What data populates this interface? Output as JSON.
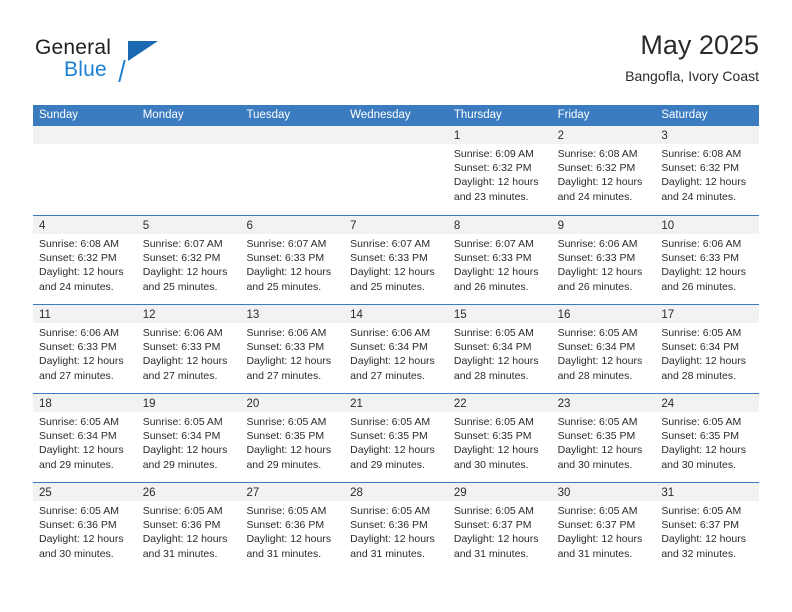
{
  "brand": {
    "name_top": "General",
    "name_bottom": "Blue",
    "triangle_color": "#1b68b3",
    "blue_text_color": "#1b7fd4"
  },
  "header": {
    "title": "May 2025",
    "subtitle": "Bangofla, Ivory Coast"
  },
  "theme": {
    "header_band": "#3b7cc0",
    "day_number_band": "#f2f2f2",
    "text": "#2b2b2b"
  },
  "weekdays": [
    "Sunday",
    "Monday",
    "Tuesday",
    "Wednesday",
    "Thursday",
    "Friday",
    "Saturday"
  ],
  "weeks": [
    [
      {
        "day": "",
        "lines": []
      },
      {
        "day": "",
        "lines": []
      },
      {
        "day": "",
        "lines": []
      },
      {
        "day": "",
        "lines": []
      },
      {
        "day": "1",
        "lines": [
          "Sunrise: 6:09 AM",
          "Sunset: 6:32 PM",
          "Daylight: 12 hours",
          "and 23 minutes."
        ]
      },
      {
        "day": "2",
        "lines": [
          "Sunrise: 6:08 AM",
          "Sunset: 6:32 PM",
          "Daylight: 12 hours",
          "and 24 minutes."
        ]
      },
      {
        "day": "3",
        "lines": [
          "Sunrise: 6:08 AM",
          "Sunset: 6:32 PM",
          "Daylight: 12 hours",
          "and 24 minutes."
        ]
      }
    ],
    [
      {
        "day": "4",
        "lines": [
          "Sunrise: 6:08 AM",
          "Sunset: 6:32 PM",
          "Daylight: 12 hours",
          "and 24 minutes."
        ]
      },
      {
        "day": "5",
        "lines": [
          "Sunrise: 6:07 AM",
          "Sunset: 6:32 PM",
          "Daylight: 12 hours",
          "and 25 minutes."
        ]
      },
      {
        "day": "6",
        "lines": [
          "Sunrise: 6:07 AM",
          "Sunset: 6:33 PM",
          "Daylight: 12 hours",
          "and 25 minutes."
        ]
      },
      {
        "day": "7",
        "lines": [
          "Sunrise: 6:07 AM",
          "Sunset: 6:33 PM",
          "Daylight: 12 hours",
          "and 25 minutes."
        ]
      },
      {
        "day": "8",
        "lines": [
          "Sunrise: 6:07 AM",
          "Sunset: 6:33 PM",
          "Daylight: 12 hours",
          "and 26 minutes."
        ]
      },
      {
        "day": "9",
        "lines": [
          "Sunrise: 6:06 AM",
          "Sunset: 6:33 PM",
          "Daylight: 12 hours",
          "and 26 minutes."
        ]
      },
      {
        "day": "10",
        "lines": [
          "Sunrise: 6:06 AM",
          "Sunset: 6:33 PM",
          "Daylight: 12 hours",
          "and 26 minutes."
        ]
      }
    ],
    [
      {
        "day": "11",
        "lines": [
          "Sunrise: 6:06 AM",
          "Sunset: 6:33 PM",
          "Daylight: 12 hours",
          "and 27 minutes."
        ]
      },
      {
        "day": "12",
        "lines": [
          "Sunrise: 6:06 AM",
          "Sunset: 6:33 PM",
          "Daylight: 12 hours",
          "and 27 minutes."
        ]
      },
      {
        "day": "13",
        "lines": [
          "Sunrise: 6:06 AM",
          "Sunset: 6:33 PM",
          "Daylight: 12 hours",
          "and 27 minutes."
        ]
      },
      {
        "day": "14",
        "lines": [
          "Sunrise: 6:06 AM",
          "Sunset: 6:34 PM",
          "Daylight: 12 hours",
          "and 27 minutes."
        ]
      },
      {
        "day": "15",
        "lines": [
          "Sunrise: 6:05 AM",
          "Sunset: 6:34 PM",
          "Daylight: 12 hours",
          "and 28 minutes."
        ]
      },
      {
        "day": "16",
        "lines": [
          "Sunrise: 6:05 AM",
          "Sunset: 6:34 PM",
          "Daylight: 12 hours",
          "and 28 minutes."
        ]
      },
      {
        "day": "17",
        "lines": [
          "Sunrise: 6:05 AM",
          "Sunset: 6:34 PM",
          "Daylight: 12 hours",
          "and 28 minutes."
        ]
      }
    ],
    [
      {
        "day": "18",
        "lines": [
          "Sunrise: 6:05 AM",
          "Sunset: 6:34 PM",
          "Daylight: 12 hours",
          "and 29 minutes."
        ]
      },
      {
        "day": "19",
        "lines": [
          "Sunrise: 6:05 AM",
          "Sunset: 6:34 PM",
          "Daylight: 12 hours",
          "and 29 minutes."
        ]
      },
      {
        "day": "20",
        "lines": [
          "Sunrise: 6:05 AM",
          "Sunset: 6:35 PM",
          "Daylight: 12 hours",
          "and 29 minutes."
        ]
      },
      {
        "day": "21",
        "lines": [
          "Sunrise: 6:05 AM",
          "Sunset: 6:35 PM",
          "Daylight: 12 hours",
          "and 29 minutes."
        ]
      },
      {
        "day": "22",
        "lines": [
          "Sunrise: 6:05 AM",
          "Sunset: 6:35 PM",
          "Daylight: 12 hours",
          "and 30 minutes."
        ]
      },
      {
        "day": "23",
        "lines": [
          "Sunrise: 6:05 AM",
          "Sunset: 6:35 PM",
          "Daylight: 12 hours",
          "and 30 minutes."
        ]
      },
      {
        "day": "24",
        "lines": [
          "Sunrise: 6:05 AM",
          "Sunset: 6:35 PM",
          "Daylight: 12 hours",
          "and 30 minutes."
        ]
      }
    ],
    [
      {
        "day": "25",
        "lines": [
          "Sunrise: 6:05 AM",
          "Sunset: 6:36 PM",
          "Daylight: 12 hours",
          "and 30 minutes."
        ]
      },
      {
        "day": "26",
        "lines": [
          "Sunrise: 6:05 AM",
          "Sunset: 6:36 PM",
          "Daylight: 12 hours",
          "and 31 minutes."
        ]
      },
      {
        "day": "27",
        "lines": [
          "Sunrise: 6:05 AM",
          "Sunset: 6:36 PM",
          "Daylight: 12 hours",
          "and 31 minutes."
        ]
      },
      {
        "day": "28",
        "lines": [
          "Sunrise: 6:05 AM",
          "Sunset: 6:36 PM",
          "Daylight: 12 hours",
          "and 31 minutes."
        ]
      },
      {
        "day": "29",
        "lines": [
          "Sunrise: 6:05 AM",
          "Sunset: 6:37 PM",
          "Daylight: 12 hours",
          "and 31 minutes."
        ]
      },
      {
        "day": "30",
        "lines": [
          "Sunrise: 6:05 AM",
          "Sunset: 6:37 PM",
          "Daylight: 12 hours",
          "and 31 minutes."
        ]
      },
      {
        "day": "31",
        "lines": [
          "Sunrise: 6:05 AM",
          "Sunset: 6:37 PM",
          "Daylight: 12 hours",
          "and 32 minutes."
        ]
      }
    ]
  ]
}
